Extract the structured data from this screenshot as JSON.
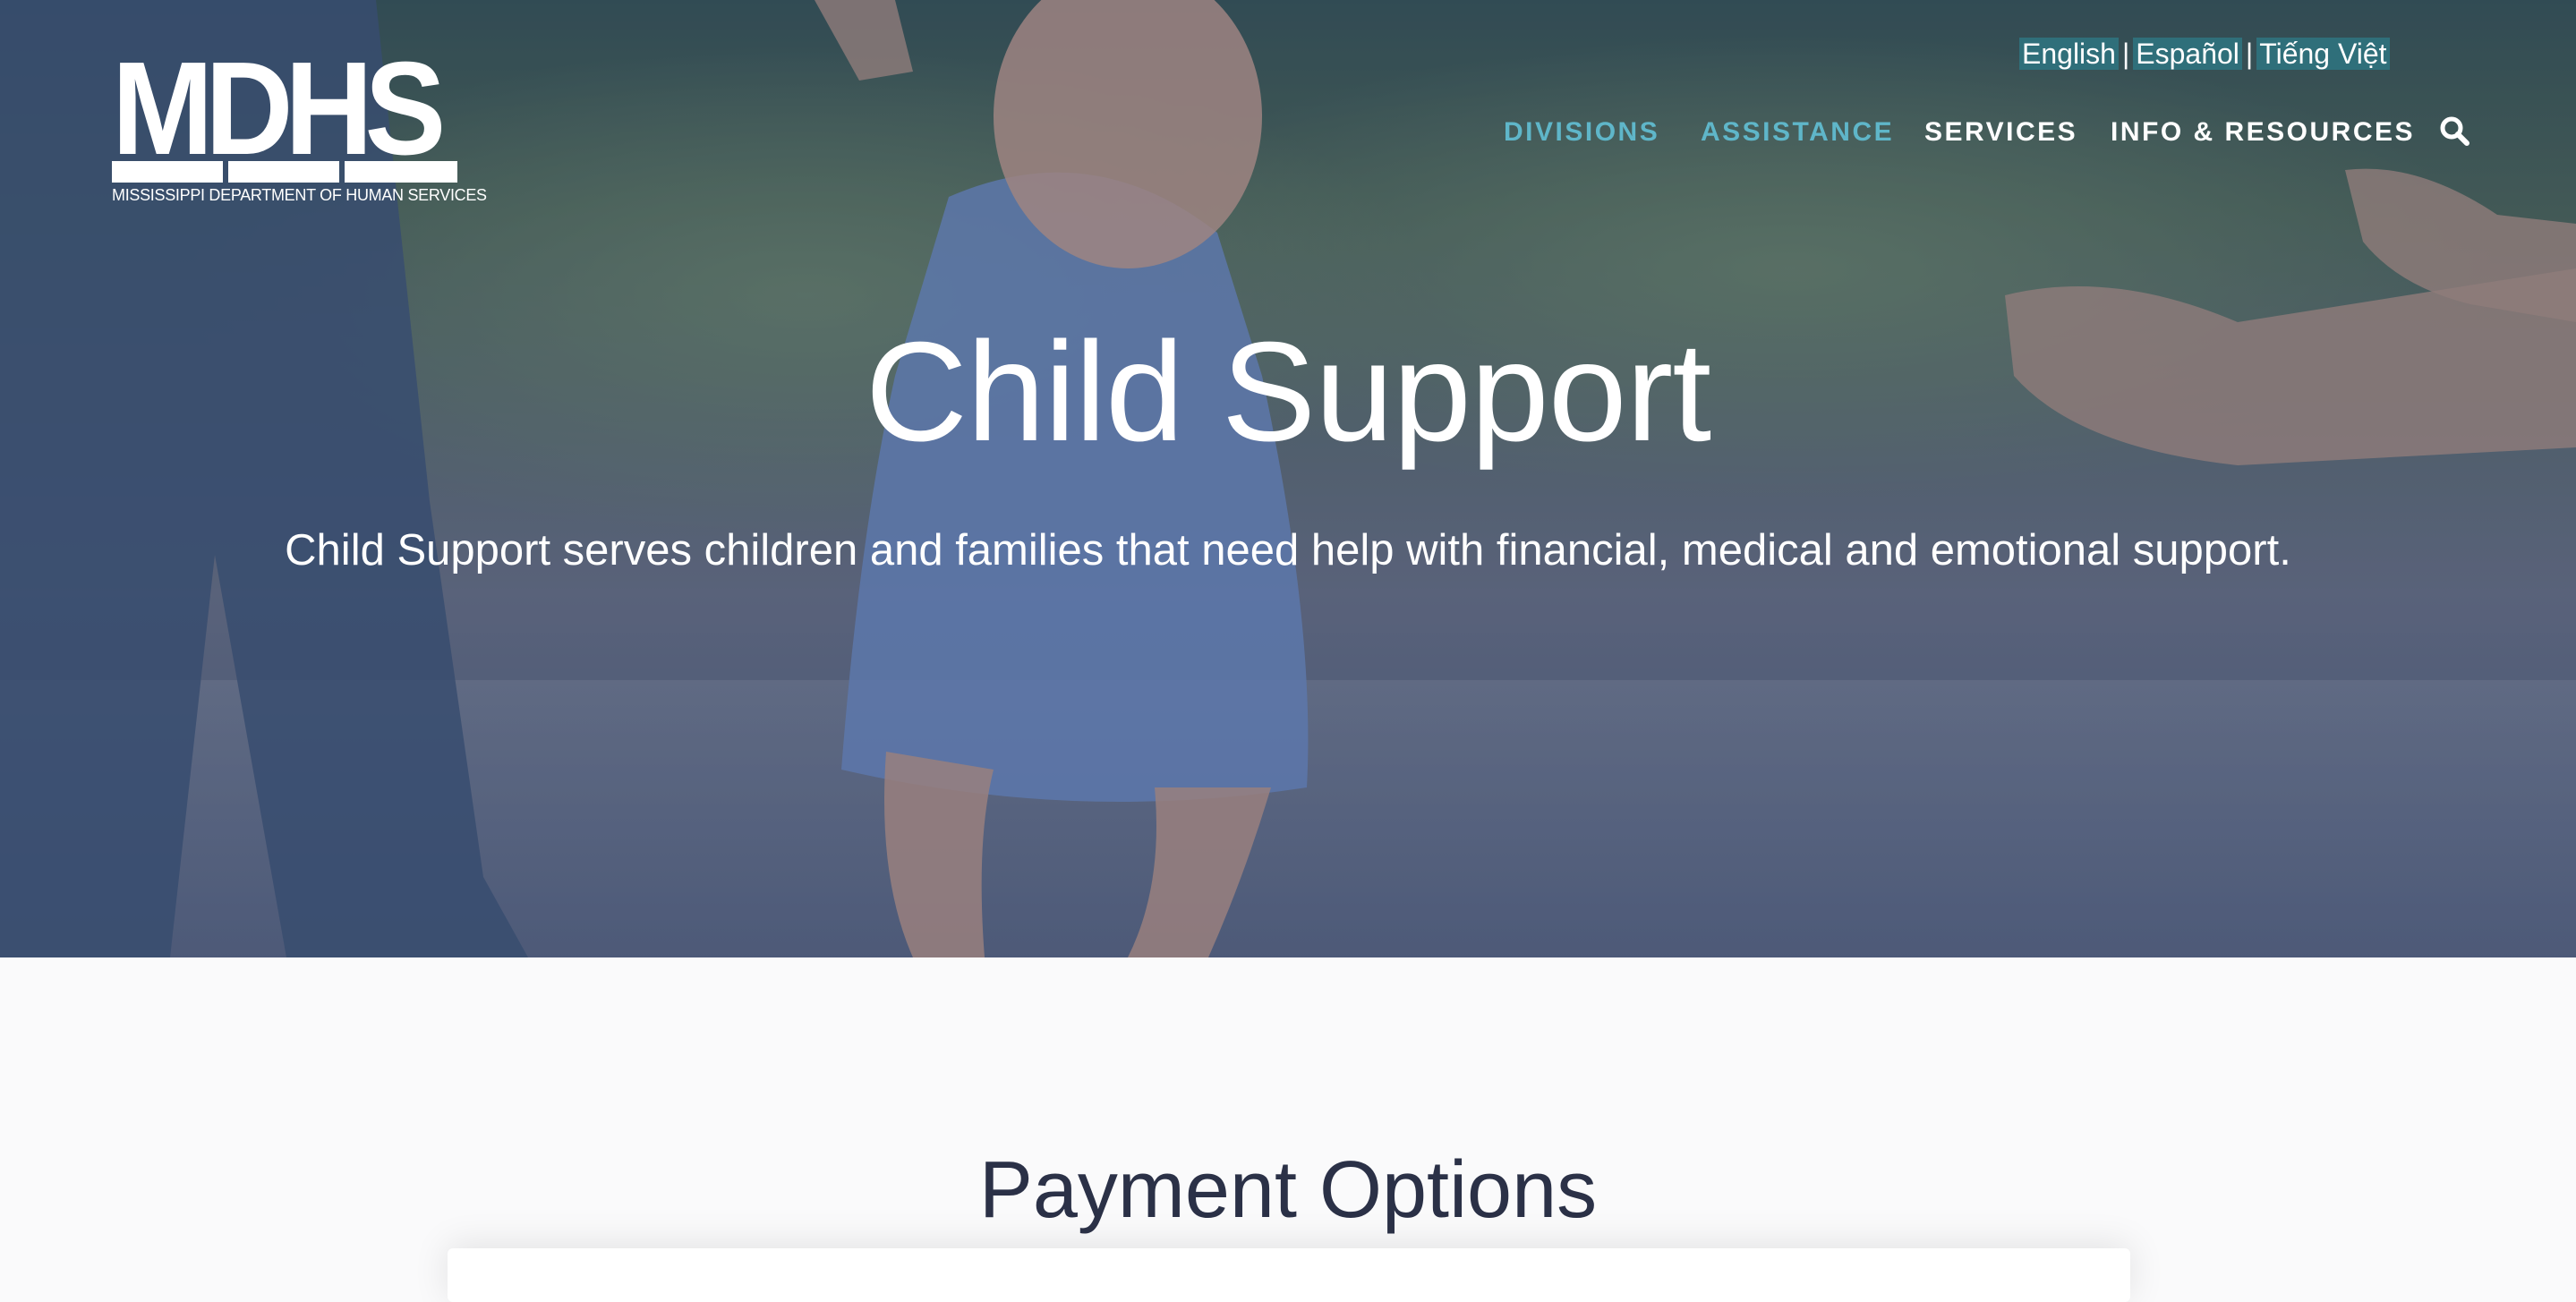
{
  "brand": {
    "logo_text": "MDHS",
    "logo_subtitle": "MISSISSIPPI DEPARTMENT OF HUMAN SERVICES"
  },
  "language_switcher": {
    "options": [
      "English",
      "Español",
      "Tiếng Việt"
    ],
    "separator": "|"
  },
  "nav": {
    "items": [
      {
        "label": "DIVISIONS",
        "active": true
      },
      {
        "label": "ASSISTANCE",
        "active": true
      },
      {
        "label": "SERVICES",
        "active": false
      },
      {
        "label": "INFO & RESOURCES",
        "active": false
      }
    ],
    "search_icon": "search-icon"
  },
  "hero": {
    "title": "Child Support",
    "subtitle": "Child Support serves children and families that need help with financial, medical and emotional support."
  },
  "content": {
    "section_title": "Payment Options"
  },
  "colors": {
    "nav_active": "#5fb6c9",
    "nav_default": "#ffffff",
    "language_highlight": "#2f6f7a",
    "section_title": "#2b3147",
    "page_background": "#fafafb"
  }
}
